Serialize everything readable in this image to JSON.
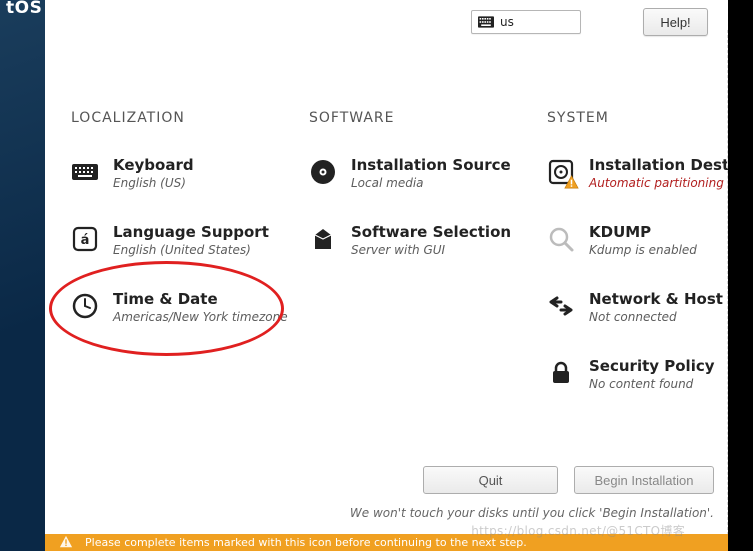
{
  "os_logo_fragment": "tOS",
  "topbar": {
    "keyboard_layout": "us",
    "help_label": "Help!"
  },
  "columns": {
    "localization": {
      "heading": "LOCALIZATION",
      "keyboard": {
        "title": "Keyboard",
        "sub": "English (US)"
      },
      "language": {
        "title": "Language Support",
        "sub": "English (United States)"
      },
      "timedate": {
        "title": "Time & Date",
        "sub": "Americas/New York timezone"
      }
    },
    "software": {
      "heading": "SOFTWARE",
      "source": {
        "title": "Installation Source",
        "sub": "Local media"
      },
      "selection": {
        "title": "Software Selection",
        "sub": "Server with GUI"
      }
    },
    "system": {
      "heading": "SYSTEM",
      "destination": {
        "title": "Installation Destination",
        "sub": "Automatic partitioning selected"
      },
      "kdump": {
        "title": "KDUMP",
        "sub": "Kdump is enabled"
      },
      "network": {
        "title": "Network & Host Name",
        "sub": "Not connected"
      },
      "security": {
        "title": "Security Policy",
        "sub": "No content found"
      }
    }
  },
  "colors": {
    "warn_red": "#b22020",
    "warnbar_bg": "#f0a021"
  },
  "footer": {
    "quit_label": "Quit",
    "begin_label": "Begin Installation",
    "hint": "We won't touch your disks until you click 'Begin Installation'."
  },
  "warn_bar_text": "Please complete items marked with this icon before continuing to the next step.",
  "watermark": "https://blog.csdn.net/@51CTO博客"
}
